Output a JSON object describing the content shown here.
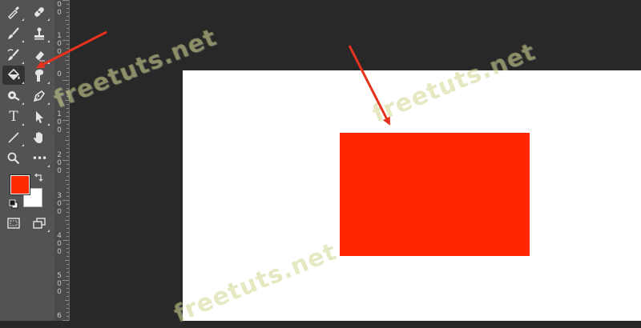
{
  "toolbar": {
    "tools": [
      {
        "name": "eyedropper-icon"
      },
      {
        "name": "spot-healing-icon"
      },
      {
        "name": "brush-icon"
      },
      {
        "name": "clone-stamp-icon"
      },
      {
        "name": "history-brush-icon"
      },
      {
        "name": "eraser-icon"
      },
      {
        "name": "paint-bucket-icon",
        "active": true
      },
      {
        "name": "smudge-icon"
      },
      {
        "name": "dodge-icon"
      },
      {
        "name": "pen-icon"
      },
      {
        "name": "type-icon",
        "glyph": "T"
      },
      {
        "name": "path-selection-icon"
      },
      {
        "name": "line-icon"
      },
      {
        "name": "hand-icon"
      },
      {
        "name": "zoom-icon"
      },
      {
        "name": "more-tools-icon",
        "glyph": "•••"
      },
      {
        "name": "swap-colors-icon"
      },
      {
        "name": "default-colors-icon"
      },
      {
        "name": "quick-mask-icon"
      },
      {
        "name": "screen-mode-icon"
      }
    ],
    "foreground_color": "#ff2a00",
    "background_color": "#ffffff"
  },
  "ruler": {
    "labels": [
      "0",
      "0",
      "1",
      "0",
      "0",
      "0",
      "1",
      "0",
      "0",
      "2",
      "0",
      "0",
      "3",
      "0",
      "0",
      "4",
      "0",
      "0",
      "5",
      "0",
      "0",
      "6"
    ]
  },
  "canvas": {
    "background": "#ffffff",
    "shape_color": "#ff2600"
  },
  "watermark": {
    "text": "freetuts.net"
  },
  "annotation_color": "#e8321e"
}
